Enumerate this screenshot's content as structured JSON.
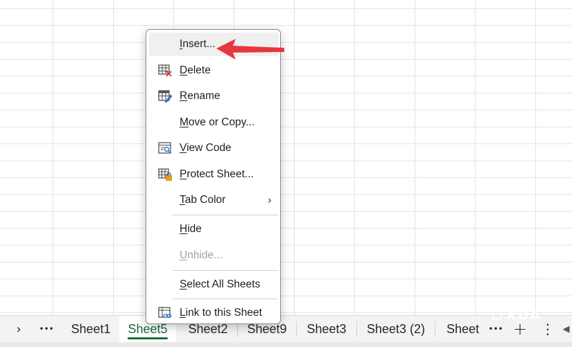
{
  "context_menu": {
    "items": [
      {
        "pre": "",
        "key": "I",
        "post": "nsert...",
        "icon": "none",
        "disabled": false,
        "hover": true
      },
      {
        "pre": "",
        "key": "D",
        "post": "elete",
        "icon": "delete-sheet-icon",
        "disabled": false
      },
      {
        "pre": "",
        "key": "R",
        "post": "ename",
        "icon": "rename-sheet-icon",
        "disabled": false
      },
      {
        "pre": "",
        "key": "M",
        "post": "ove or Copy...",
        "icon": "none",
        "disabled": false
      },
      {
        "pre": "",
        "key": "V",
        "post": "iew Code",
        "icon": "view-code-icon",
        "disabled": false
      },
      {
        "pre": "",
        "key": "P",
        "post": "rotect Sheet...",
        "icon": "protect-sheet-icon",
        "disabled": false
      },
      {
        "pre": "",
        "key": "T",
        "post": "ab Color",
        "icon": "none",
        "disabled": false,
        "submenu": "›"
      },
      {
        "pre": "",
        "key": "H",
        "post": "ide",
        "icon": "none",
        "disabled": false
      },
      {
        "pre": "",
        "key": "U",
        "post": "nhide...",
        "icon": "none",
        "disabled": true
      },
      {
        "pre": "",
        "key": "S",
        "post": "elect All Sheets",
        "icon": "none",
        "disabled": false
      },
      {
        "pre": "",
        "key": "L",
        "post": "ink to this Sheet",
        "icon": "link-sheet-icon",
        "disabled": false
      }
    ]
  },
  "tabbar": {
    "nav_next": "›",
    "more": "•••",
    "tabs": [
      "Sheet1",
      "Sheet5",
      "Sheet2",
      "Sheet9",
      "Sheet3",
      "Sheet3 (2)",
      "Sheet"
    ],
    "active_tab": "Sheet5",
    "overflow": "•••",
    "add": "+",
    "options": "⋮",
    "scroll": "◀"
  },
  "watermark": "XDA",
  "colors": {
    "accent_green": "#1b6b3a",
    "annotation_red": "#e8363d",
    "menu_border": "#8a8a8a",
    "grid_line": "#e3e3e3"
  }
}
